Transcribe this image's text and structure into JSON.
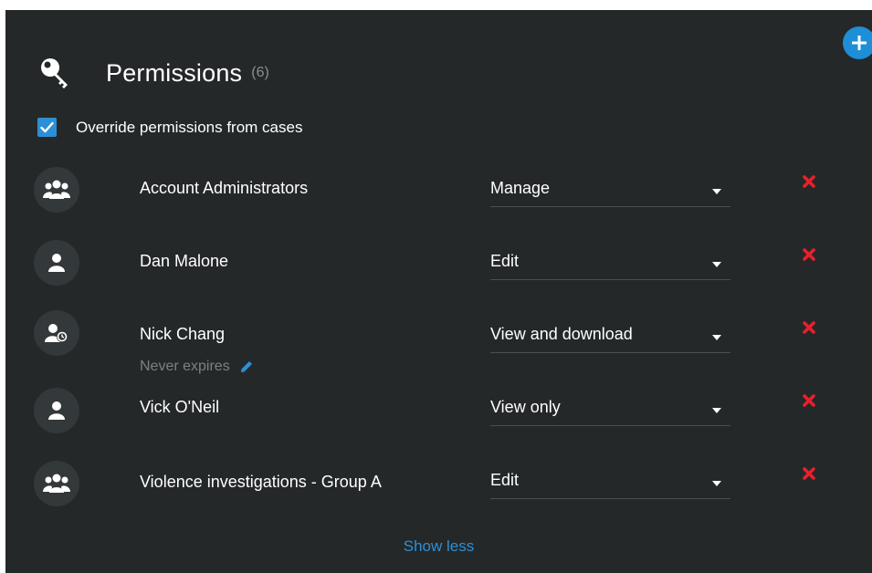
{
  "header": {
    "title": "Permissions",
    "count": "(6)"
  },
  "override": {
    "label": "Override permissions from cases",
    "checked": true
  },
  "permissions": [
    {
      "name": "Account Administrators",
      "type": "group-icon",
      "level": "Manage"
    },
    {
      "name": "Dan Malone",
      "type": "user-icon",
      "level": "Edit"
    },
    {
      "name": "Nick Chang",
      "type": "user-clock-icon",
      "level": "View and download",
      "expiry": "Never expires"
    },
    {
      "name": "Vick O'Neil",
      "type": "user-icon",
      "level": "View only"
    },
    {
      "name": "Violence investigations - Group A",
      "type": "group-icon",
      "level": "Edit"
    }
  ],
  "footer": {
    "show_less": "Show less"
  },
  "colors": {
    "panel_bg": "#252829",
    "accent": "#2d8fd5",
    "remove": "#e8202a",
    "muted_text": "#7c8183"
  }
}
